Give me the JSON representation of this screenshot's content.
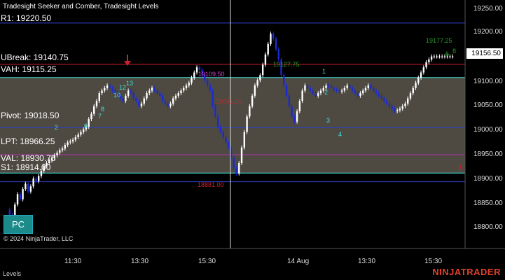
{
  "indicator_title": "Tradesight Seeker and Comber, Tradesight Levels",
  "levels": [
    {
      "key": "r1",
      "label": "R1: 19220.50",
      "price": 19220.5,
      "color": "#2d3fcf"
    },
    {
      "key": "ubreak",
      "label": "UBreak: 19140.75",
      "price": 19140.75,
      "color": "#d02030"
    },
    {
      "key": "vah",
      "label": "VAH: 19115.25",
      "price": 19115.25,
      "color": "#40e0e0"
    },
    {
      "key": "pivot",
      "label": "Pivot: 19018.50",
      "price": 19018.5,
      "color": "#2d3fcf"
    },
    {
      "key": "lpt",
      "label": "LPT: 18966.25",
      "price": 18966.25,
      "color": "#b030b0"
    },
    {
      "key": "val",
      "label": "VAL: 18930.75",
      "price": 18930.75,
      "color": "#40e0e0"
    },
    {
      "key": "s1",
      "label": "S1: 18914.00",
      "price": 18914.0,
      "color": "#2d3fcf"
    }
  ],
  "price_axis": {
    "ticks": [
      "19250.00",
      "19200.00",
      "19150.00",
      "19100.00",
      "19050.00",
      "19000.00",
      "18950.00",
      "18900.00",
      "18850.00",
      "18800.00"
    ],
    "tick_values": [
      19250,
      19200,
      19150,
      19100,
      19050,
      19000,
      18950,
      18900,
      18850,
      18800
    ],
    "ylim": [
      18785,
      19265
    ],
    "current_price": "19156.50",
    "current_price_value": 19156.5
  },
  "time_axis": {
    "ticks": [
      {
        "label": "11:30",
        "pos": 0.152
      },
      {
        "label": "13:30",
        "pos": 0.297
      },
      {
        "label": "15:30",
        "pos": 0.442
      },
      {
        "label": "14 Aug",
        "pos": 0.643
      },
      {
        "label": "13:30",
        "pos": 0.79
      },
      {
        "label": "15:30",
        "pos": 0.935
      }
    ]
  },
  "annotations": [
    {
      "text": "19177.25",
      "color": "#2a9a2a"
    },
    {
      "text": "19127.75",
      "color": "#2a9a2a"
    },
    {
      "text": "19109.50",
      "color": "#d040d0"
    },
    {
      "text": "19061.00",
      "color": "#d02030"
    },
    {
      "text": "18881.00",
      "color": "#d02030"
    }
  ],
  "pc_button": "PC",
  "copyright": "© 2024 NinjaTrader, LLC",
  "bottom_tab": "Levels",
  "brand": "NINJATRADER",
  "colors": {
    "value_area_fill": "#4e4a41",
    "up_candle": "#ffffff",
    "down_candle": "#1a2ad0",
    "crosshair": "#dddddd"
  },
  "chart_data": {
    "type": "candlestick",
    "ylim": [
      18785,
      19265
    ],
    "bar_count": 170,
    "closes": [
      18860,
      18850,
      18835,
      18870,
      18890,
      18880,
      18900,
      18910,
      18895,
      18905,
      18920,
      18915,
      18925,
      18935,
      18945,
      18950,
      18955,
      18960,
      18965,
      18970,
      18975,
      18978,
      18985,
      18990,
      18992,
      18995,
      19000,
      19005,
      19010,
      19015,
      19020,
      19035,
      19045,
      19060,
      19070,
      19085,
      19090,
      19095,
      19100,
      19095,
      19090,
      19085,
      19080,
      19075,
      19070,
      19080,
      19090,
      19085,
      19075,
      19070,
      19060,
      19065,
      19075,
      19085,
      19090,
      19095,
      19090,
      19085,
      19080,
      19070,
      19065,
      19060,
      19065,
      19075,
      19080,
      19085,
      19090,
      19095,
      19100,
      19105,
      19115,
      19125,
      19135,
      19130,
      19120,
      19110,
      19100,
      19090,
      19060,
      19040,
      19020,
      19010,
      19000,
      18990,
      18980,
      18960,
      18940,
      18930,
      18950,
      18980,
      19010,
      19040,
      19060,
      19080,
      19100,
      19110,
      19120,
      19140,
      19160,
      19180,
      19200,
      19190,
      19170,
      19150,
      19120,
      19100,
      19080,
      19060,
      19040,
      19030,
      19050,
      19070,
      19090,
      19100,
      19095,
      19090,
      19085,
      19080,
      19085,
      19090,
      19095,
      19100,
      19098,
      19095,
      19092,
      19090,
      19088,
      19090,
      19095,
      19100,
      19095,
      19090,
      19085,
      19080,
      19085,
      19090,
      19095,
      19100,
      19095,
      19090,
      19085,
      19080,
      19075,
      19070,
      19065,
      19060,
      19055,
      19050,
      19052,
      19055,
      19060,
      19065,
      19075,
      19085,
      19095,
      19105,
      19115,
      19125,
      19135,
      19145,
      19150,
      19156,
      19156,
      19156,
      19156,
      19156,
      19156,
      19156,
      19156,
      19156
    ]
  }
}
